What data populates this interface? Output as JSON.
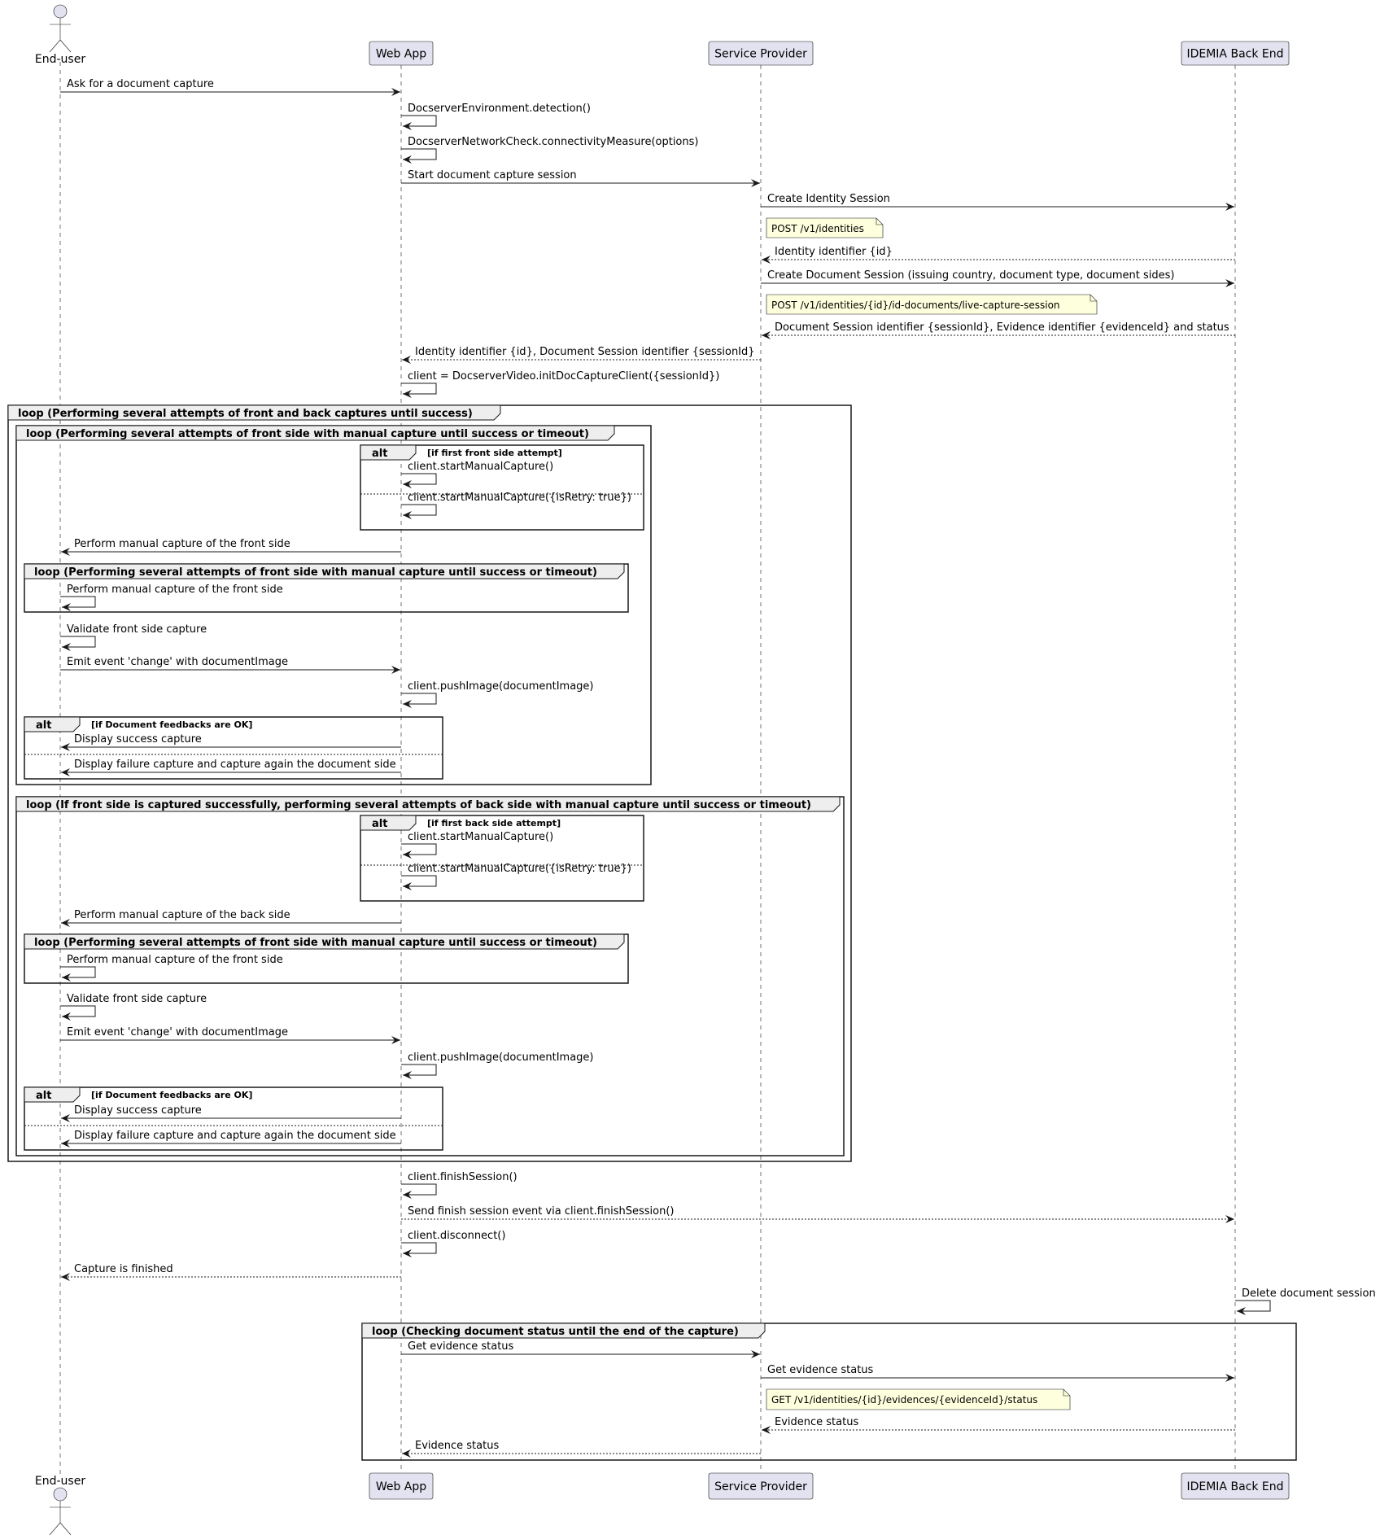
{
  "diagram": {
    "type": "sequence",
    "colors": {
      "participant_fill": "#E2E2F0",
      "participant_stroke": "#181818",
      "note_fill": "#FEFFDD",
      "fragment_tab_fill": "#EEEEEE",
      "line": "#181818"
    },
    "participants": [
      {
        "id": "enduser",
        "label": "End-user",
        "kind": "actor"
      },
      {
        "id": "webapp",
        "label": "Web App",
        "kind": "participant"
      },
      {
        "id": "sp",
        "label": "Service Provider",
        "kind": "participant"
      },
      {
        "id": "idemia",
        "label": "IDEMIA Back End",
        "kind": "participant"
      }
    ],
    "messages": [
      {
        "from": "enduser",
        "to": "webapp",
        "label": "Ask for a document capture",
        "style": "solid"
      },
      {
        "from": "webapp",
        "to": "webapp",
        "label": "DocserverEnvironment.detection()",
        "style": "solid"
      },
      {
        "from": "webapp",
        "to": "webapp",
        "label": "DocserverNetworkCheck.connectivityMeasure(options)",
        "style": "solid"
      },
      {
        "from": "webapp",
        "to": "sp",
        "label": "Start document capture session",
        "style": "solid"
      },
      {
        "from": "sp",
        "to": "idemia",
        "label": "Create Identity Session",
        "style": "solid"
      },
      {
        "from": "idemia",
        "to": "sp",
        "label": "Identity identifier {id}",
        "style": "dashed"
      },
      {
        "from": "sp",
        "to": "idemia",
        "label": "Create Document Session (issuing country, document type, document sides)",
        "style": "solid"
      },
      {
        "from": "idemia",
        "to": "sp",
        "label": "Document Session identifier {sessionId}, Evidence identifier {evidenceId} and status",
        "style": "dashed"
      },
      {
        "from": "sp",
        "to": "webapp",
        "label": "Identity identifier {id}, Document Session identifier {sessionId}",
        "style": "dashed"
      },
      {
        "from": "webapp",
        "to": "webapp",
        "label": "client = DocserverVideo.initDocCaptureClient({sessionId})",
        "style": "solid"
      },
      {
        "from": "webapp",
        "to": "webapp",
        "label": "client.startManualCapture()",
        "style": "solid"
      },
      {
        "from": "webapp",
        "to": "webapp",
        "label": "client.startManualCapture({isRetry: true})",
        "style": "solid"
      },
      {
        "from": "webapp",
        "to": "enduser",
        "label": "Perform manual capture of the front side",
        "style": "solid"
      },
      {
        "from": "enduser",
        "to": "enduser",
        "label": "Perform manual capture of the front side",
        "style": "solid"
      },
      {
        "from": "enduser",
        "to": "enduser",
        "label": "Validate front side capture",
        "style": "solid"
      },
      {
        "from": "enduser",
        "to": "webapp",
        "label": "Emit event 'change' with documentImage",
        "style": "solid"
      },
      {
        "from": "webapp",
        "to": "webapp",
        "label": "client.pushImage(documentImage)",
        "style": "solid"
      },
      {
        "from": "webapp",
        "to": "enduser",
        "label": "Display success capture",
        "style": "solid"
      },
      {
        "from": "webapp",
        "to": "enduser",
        "label": "Display failure capture and capture again the document side",
        "style": "solid"
      },
      {
        "from": "webapp",
        "to": "webapp",
        "label": "client.startManualCapture()",
        "style": "solid"
      },
      {
        "from": "webapp",
        "to": "webapp",
        "label": "client.startManualCapture({isRetry: true})",
        "style": "solid"
      },
      {
        "from": "webapp",
        "to": "enduser",
        "label": "Perform manual capture of the back side",
        "style": "solid"
      },
      {
        "from": "enduser",
        "to": "enduser",
        "label": "Perform manual capture of the front side",
        "style": "solid"
      },
      {
        "from": "enduser",
        "to": "enduser",
        "label": "Validate front side capture",
        "style": "solid"
      },
      {
        "from": "enduser",
        "to": "webapp",
        "label": "Emit event 'change' with documentImage",
        "style": "solid"
      },
      {
        "from": "webapp",
        "to": "webapp",
        "label": "client.pushImage(documentImage)",
        "style": "solid"
      },
      {
        "from": "webapp",
        "to": "enduser",
        "label": "Display success capture",
        "style": "solid"
      },
      {
        "from": "webapp",
        "to": "enduser",
        "label": "Display failure capture and capture again the document side",
        "style": "solid"
      },
      {
        "from": "webapp",
        "to": "webapp",
        "label": "client.finishSession()",
        "style": "solid"
      },
      {
        "from": "webapp",
        "to": "idemia",
        "label": "Send finish session event via client.finishSession()",
        "style": "dashed"
      },
      {
        "from": "webapp",
        "to": "webapp",
        "label": "client.disconnect()",
        "style": "solid"
      },
      {
        "from": "webapp",
        "to": "enduser",
        "label": "Capture is finished",
        "style": "dashed"
      },
      {
        "from": "idemia",
        "to": "idemia",
        "label": "Delete document session",
        "style": "solid"
      },
      {
        "from": "webapp",
        "to": "sp",
        "label": "Get evidence status",
        "style": "solid"
      },
      {
        "from": "sp",
        "to": "idemia",
        "label": "Get evidence status",
        "style": "solid"
      },
      {
        "from": "idemia",
        "to": "sp",
        "label": "Evidence status",
        "style": "dashed"
      },
      {
        "from": "sp",
        "to": "webapp",
        "label": "Evidence status",
        "style": "dashed"
      }
    ],
    "notes": [
      {
        "over": "sp",
        "text": "POST /v1/identities"
      },
      {
        "over": "sp",
        "text": "POST /v1/identities/{id}/id-documents/live-capture-session"
      },
      {
        "over": "sp",
        "text": "GET /v1/identities/{id}/evidences/{evidenceId}/status"
      }
    ],
    "fragments": [
      {
        "kind": "loop",
        "title": "loop (Performing several attempts of front and back captures until success)"
      },
      {
        "kind": "loop",
        "title": "loop (Performing several attempts of front side with manual capture until success or timeout)"
      },
      {
        "kind": "alt",
        "title": "alt",
        "condition": "[if first front side attempt]"
      },
      {
        "kind": "loop",
        "title": "loop (Performing several attempts of front side with manual capture until success or timeout)"
      },
      {
        "kind": "alt",
        "title": "alt",
        "condition": "[if Document feedbacks are OK]"
      },
      {
        "kind": "loop",
        "title": "loop (If front side is captured successfully, performing several attempts of back side with manual capture until success or timeout)"
      },
      {
        "kind": "alt",
        "title": "alt",
        "condition": "[if first back side attempt]"
      },
      {
        "kind": "loop",
        "title": "loop (Performing several attempts of front side with manual capture until success or timeout)"
      },
      {
        "kind": "alt",
        "title": "alt",
        "condition": "[if Document feedbacks are OK]"
      },
      {
        "kind": "loop",
        "title": "loop (Checking document status until the end of the capture)"
      }
    ]
  }
}
